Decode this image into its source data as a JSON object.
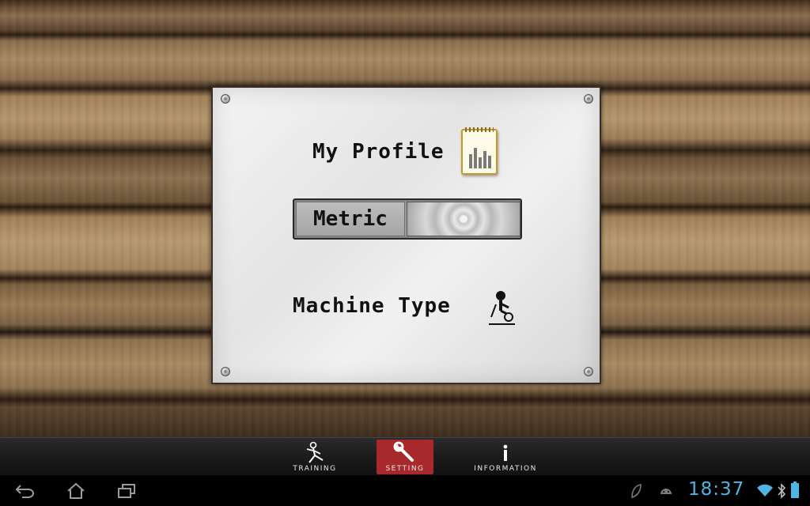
{
  "profile": {
    "title": "My Profile",
    "icon": "notepad-icon"
  },
  "units_toggle": {
    "label": "Metric"
  },
  "machine": {
    "label": "Machine Type",
    "icon": "exercise-bike-icon"
  },
  "tabs": [
    {
      "label": "TRAINING",
      "icon": "running-figure-icon",
      "active": false
    },
    {
      "label": "SETTING",
      "icon": "wrench-icon",
      "active": true
    },
    {
      "label": "INFORMATION",
      "icon": "info-icon",
      "active": false
    }
  ],
  "system_bar": {
    "clock": "18:37",
    "nav": [
      "back-icon",
      "home-icon",
      "recent-apps-icon"
    ],
    "status_icons": [
      "leaf-icon",
      "android-icon",
      "wifi-icon",
      "bluetooth-icon",
      "battery-icon"
    ]
  },
  "colors": {
    "active_tab": "#a8292b",
    "clock": "#4fb3e3"
  }
}
